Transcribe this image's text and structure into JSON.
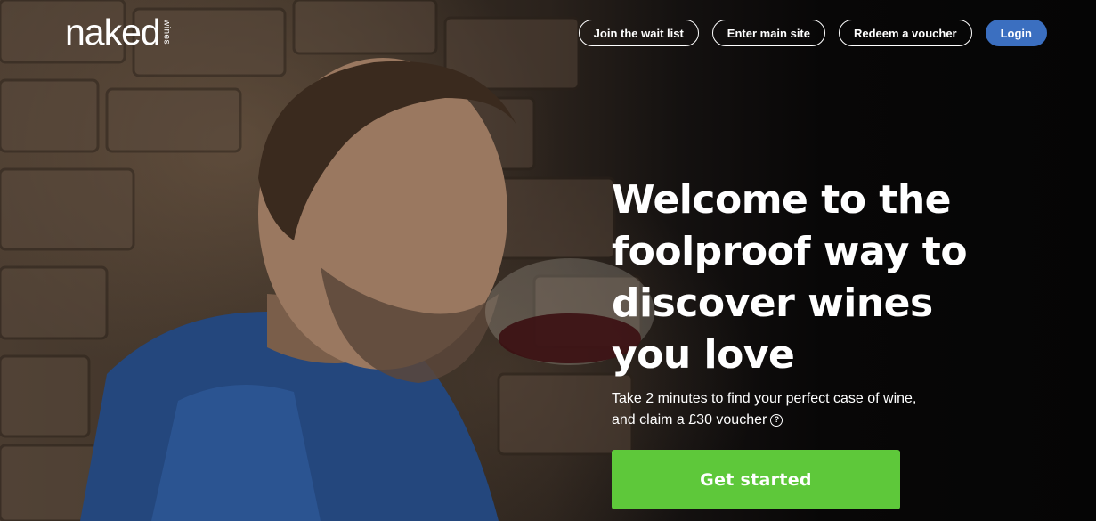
{
  "brand": {
    "wordmark": "naked",
    "sub": "wines"
  },
  "nav": {
    "wait_list": "Join the wait list",
    "main_site": "Enter main site",
    "voucher": "Redeem a voucher",
    "login": "Login"
  },
  "hero": {
    "headline_lines": [
      "Welcome to the",
      "foolproof way to",
      "discover wines",
      "you love"
    ],
    "sub_line1": "Take 2 minutes to find your perfect case of wine,",
    "sub_line2": "and claim a £30 voucher",
    "help_glyph": "?",
    "cta": "Get started"
  },
  "colors": {
    "login_bg": "#3b6fc0",
    "cta_bg": "#5ec83a",
    "text": "#ffffff"
  }
}
